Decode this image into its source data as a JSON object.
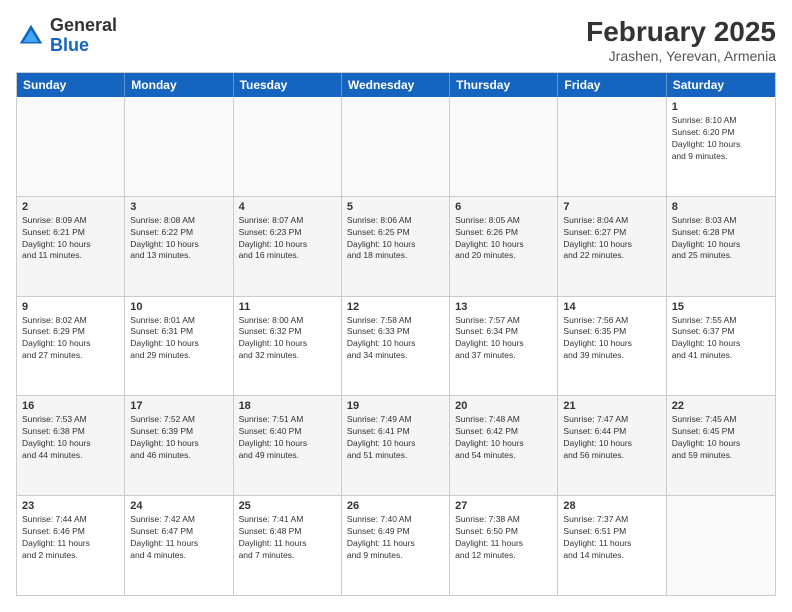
{
  "header": {
    "logo_general": "General",
    "logo_blue": "Blue",
    "title": "February 2025",
    "location": "Jrashen, Yerevan, Armenia"
  },
  "days_of_week": [
    "Sunday",
    "Monday",
    "Tuesday",
    "Wednesday",
    "Thursday",
    "Friday",
    "Saturday"
  ],
  "weeks": [
    [
      {
        "day": "",
        "text": ""
      },
      {
        "day": "",
        "text": ""
      },
      {
        "day": "",
        "text": ""
      },
      {
        "day": "",
        "text": ""
      },
      {
        "day": "",
        "text": ""
      },
      {
        "day": "",
        "text": ""
      },
      {
        "day": "1",
        "text": "Sunrise: 8:10 AM\nSunset: 6:20 PM\nDaylight: 10 hours\nand 9 minutes."
      }
    ],
    [
      {
        "day": "2",
        "text": "Sunrise: 8:09 AM\nSunset: 6:21 PM\nDaylight: 10 hours\nand 11 minutes."
      },
      {
        "day": "3",
        "text": "Sunrise: 8:08 AM\nSunset: 6:22 PM\nDaylight: 10 hours\nand 13 minutes."
      },
      {
        "day": "4",
        "text": "Sunrise: 8:07 AM\nSunset: 6:23 PM\nDaylight: 10 hours\nand 16 minutes."
      },
      {
        "day": "5",
        "text": "Sunrise: 8:06 AM\nSunset: 6:25 PM\nDaylight: 10 hours\nand 18 minutes."
      },
      {
        "day": "6",
        "text": "Sunrise: 8:05 AM\nSunset: 6:26 PM\nDaylight: 10 hours\nand 20 minutes."
      },
      {
        "day": "7",
        "text": "Sunrise: 8:04 AM\nSunset: 6:27 PM\nDaylight: 10 hours\nand 22 minutes."
      },
      {
        "day": "8",
        "text": "Sunrise: 8:03 AM\nSunset: 6:28 PM\nDaylight: 10 hours\nand 25 minutes."
      }
    ],
    [
      {
        "day": "9",
        "text": "Sunrise: 8:02 AM\nSunset: 6:29 PM\nDaylight: 10 hours\nand 27 minutes."
      },
      {
        "day": "10",
        "text": "Sunrise: 8:01 AM\nSunset: 6:31 PM\nDaylight: 10 hours\nand 29 minutes."
      },
      {
        "day": "11",
        "text": "Sunrise: 8:00 AM\nSunset: 6:32 PM\nDaylight: 10 hours\nand 32 minutes."
      },
      {
        "day": "12",
        "text": "Sunrise: 7:58 AM\nSunset: 6:33 PM\nDaylight: 10 hours\nand 34 minutes."
      },
      {
        "day": "13",
        "text": "Sunrise: 7:57 AM\nSunset: 6:34 PM\nDaylight: 10 hours\nand 37 minutes."
      },
      {
        "day": "14",
        "text": "Sunrise: 7:56 AM\nSunset: 6:35 PM\nDaylight: 10 hours\nand 39 minutes."
      },
      {
        "day": "15",
        "text": "Sunrise: 7:55 AM\nSunset: 6:37 PM\nDaylight: 10 hours\nand 41 minutes."
      }
    ],
    [
      {
        "day": "16",
        "text": "Sunrise: 7:53 AM\nSunset: 6:38 PM\nDaylight: 10 hours\nand 44 minutes."
      },
      {
        "day": "17",
        "text": "Sunrise: 7:52 AM\nSunset: 6:39 PM\nDaylight: 10 hours\nand 46 minutes."
      },
      {
        "day": "18",
        "text": "Sunrise: 7:51 AM\nSunset: 6:40 PM\nDaylight: 10 hours\nand 49 minutes."
      },
      {
        "day": "19",
        "text": "Sunrise: 7:49 AM\nSunset: 6:41 PM\nDaylight: 10 hours\nand 51 minutes."
      },
      {
        "day": "20",
        "text": "Sunrise: 7:48 AM\nSunset: 6:42 PM\nDaylight: 10 hours\nand 54 minutes."
      },
      {
        "day": "21",
        "text": "Sunrise: 7:47 AM\nSunset: 6:44 PM\nDaylight: 10 hours\nand 56 minutes."
      },
      {
        "day": "22",
        "text": "Sunrise: 7:45 AM\nSunset: 6:45 PM\nDaylight: 10 hours\nand 59 minutes."
      }
    ],
    [
      {
        "day": "23",
        "text": "Sunrise: 7:44 AM\nSunset: 6:46 PM\nDaylight: 11 hours\nand 2 minutes."
      },
      {
        "day": "24",
        "text": "Sunrise: 7:42 AM\nSunset: 6:47 PM\nDaylight: 11 hours\nand 4 minutes."
      },
      {
        "day": "25",
        "text": "Sunrise: 7:41 AM\nSunset: 6:48 PM\nDaylight: 11 hours\nand 7 minutes."
      },
      {
        "day": "26",
        "text": "Sunrise: 7:40 AM\nSunset: 6:49 PM\nDaylight: 11 hours\nand 9 minutes."
      },
      {
        "day": "27",
        "text": "Sunrise: 7:38 AM\nSunset: 6:50 PM\nDaylight: 11 hours\nand 12 minutes."
      },
      {
        "day": "28",
        "text": "Sunrise: 7:37 AM\nSunset: 6:51 PM\nDaylight: 11 hours\nand 14 minutes."
      },
      {
        "day": "",
        "text": ""
      }
    ]
  ]
}
